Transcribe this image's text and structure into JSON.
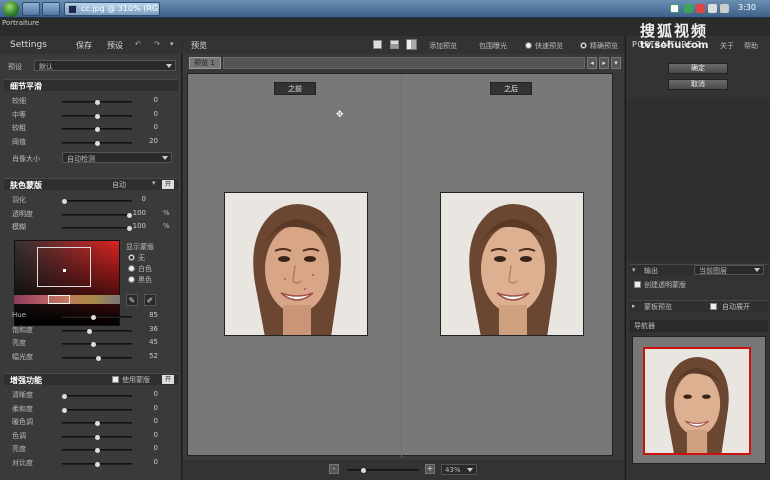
{
  "taskbar": {
    "window_title": "cc.jpg @ 310% (RG...",
    "clock": "3:30"
  },
  "app": {
    "logo_text": "Portraiture",
    "watermark_cn": "搜狐视频",
    "watermark_url": "tv.sohu.com"
  },
  "left": {
    "settings_label": "Settings",
    "save_label": "保存",
    "preset_label": "预设",
    "preset_row_label": "预设",
    "preset_value": "默认",
    "detail": {
      "title": "细节平滑",
      "sliders": [
        {
          "label": "较细",
          "value": "0",
          "pos": 0.5
        },
        {
          "label": "中等",
          "value": "0",
          "pos": 0.5
        },
        {
          "label": "较粗",
          "value": "0",
          "pos": 0.5
        },
        {
          "label": "阈值",
          "value": "20",
          "pos": 0.5
        }
      ],
      "size_label": "肖像大小",
      "size_value": "自动检测"
    },
    "skin": {
      "title": "肤色蒙版",
      "mode_value": "自动",
      "toggle": "开",
      "sliders": [
        {
          "label": "羽化",
          "value": "0",
          "unit": "",
          "pos": 0.0
        },
        {
          "label": "透明度",
          "value": "100",
          "unit": "%",
          "pos": 1.0
        },
        {
          "label": "模糊",
          "value": "100",
          "unit": "%",
          "pos": 1.0
        }
      ],
      "show_mask_label": "显示蒙版",
      "radios": [
        {
          "label": "无",
          "selected": true
        },
        {
          "label": "白色",
          "selected": false
        },
        {
          "label": "黑色",
          "selected": false
        }
      ],
      "hsl": [
        {
          "label": "Hue",
          "value": "85",
          "pos": 0.45
        },
        {
          "label": "饱和度",
          "value": "36",
          "pos": 0.38
        },
        {
          "label": "亮度",
          "value": "45",
          "pos": 0.45
        },
        {
          "label": "幅光度",
          "value": "52",
          "pos": 0.52
        }
      ]
    },
    "enhance": {
      "title": "增强功能",
      "use_mask_label": "使用蒙版",
      "toggle": "开",
      "sliders": [
        {
          "label": "清晰度",
          "value": "0",
          "pos": 0.0
        },
        {
          "label": "柔和度",
          "value": "0",
          "pos": 0.0
        },
        {
          "label": "暖色调",
          "value": "0",
          "pos": 0.5
        },
        {
          "label": "色调",
          "value": "0",
          "pos": 0.5
        },
        {
          "label": "亮度",
          "value": "0",
          "pos": 0.5
        },
        {
          "label": "对比度",
          "value": "0",
          "pos": 0.5
        }
      ]
    }
  },
  "center": {
    "preview_label": "预览",
    "add_preview": "添加预览",
    "bracket_exposure": "包围曝光",
    "quick_preview": "快速预览",
    "precise_preview": "精确预览",
    "tab_name": "预览 1",
    "before_label": "之前",
    "after_label": "之后",
    "zoom_value": "43%",
    "zoom_slider_pos": 0.2
  },
  "right": {
    "product_name": "PORTRAITURE 2",
    "about": "关于",
    "help": "帮助",
    "ok": "确定",
    "cancel": "取消",
    "output_label": "输出",
    "output_value": "当前图层",
    "create_mask": "创建透明蒙版",
    "mask_preview": "蒙板预览",
    "auto_expand": "自动展开",
    "navigator": "导航器"
  }
}
